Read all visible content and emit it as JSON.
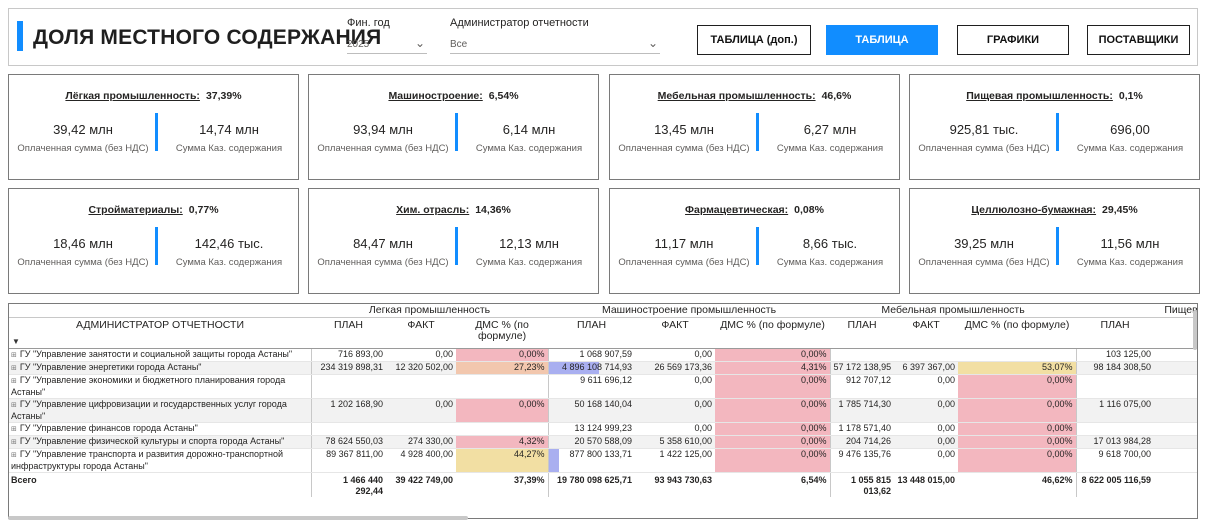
{
  "header": {
    "title": "ДОЛЯ МЕСТНОГО СОДЕРЖАНИЯ",
    "year_label": "Фин. год",
    "year_value": "2025",
    "admin_label": "Администратор отчетности",
    "admin_value": "Все",
    "buttons": [
      "ТАБЛИЦА (доп.)",
      "ТАБЛИЦА",
      "ГРАФИКИ",
      "ПОСТАВЩИКИ"
    ],
    "active_button": "ТАБЛИЦА",
    "accent_color": "#118dff"
  },
  "cards": [
    {
      "name": "Лёгкая промышленность:",
      "pct": "37,39%",
      "paid": "39,42 млн",
      "paid_label": "Оплаченная сумма (без НДС)",
      "kaz": "14,74 млн",
      "kaz_label": "Сумма Каз. содержания"
    },
    {
      "name": "Машиностроение:",
      "pct": "6,54%",
      "paid": "93,94 млн",
      "paid_label": "Оплаченная сумма (без НДС)",
      "kaz": "6,14 млн",
      "kaz_label": "Сумма Каз. содержания"
    },
    {
      "name": "Мебельная промышленность:",
      "pct": "46,6%",
      "paid": "13,45 млн",
      "paid_label": "Оплаченная сумма (без НДС)",
      "kaz": "6,27 млн",
      "kaz_label": "Сумма Каз. содержания"
    },
    {
      "name": "Пищевая промышленность:",
      "pct": "0,1%",
      "paid": "925,81 тыс.",
      "paid_label": "Оплаченная сумма (без НДС)",
      "kaz": "696,00",
      "kaz_label": "Сумма Каз. содержания"
    },
    {
      "name": "Стройматериалы:",
      "pct": "0,77%",
      "paid": "18,46 млн",
      "paid_label": "Оплаченная сумма (без НДС)",
      "kaz": "142,46 тыс.",
      "kaz_label": "Сумма Каз. содержания"
    },
    {
      "name": "Хим. отрасль:",
      "pct": "14,36%",
      "paid": "84,47 млн",
      "paid_label": "Оплаченная сумма (без НДС)",
      "kaz": "12,13 млн",
      "kaz_label": "Сумма Каз. содержания"
    },
    {
      "name": "Фармацевтическая:",
      "pct": "0,08%",
      "paid": "11,17 млн",
      "paid_label": "Оплаченная сумма (без НДС)",
      "kaz": "8,66 тыс.",
      "kaz_label": "Сумма Каз. содержания"
    },
    {
      "name": "Целлюлозно-бумажная:",
      "pct": "29,45%",
      "paid": "39,25 млн",
      "paid_label": "Оплаченная сумма (без НДС)",
      "kaz": "11,56 млн",
      "kaz_label": "Сумма Каз. содержания"
    }
  ],
  "table": {
    "groups": [
      "Легкая промышленность",
      "Машиностроение промышленность",
      "Мебельная промышленность",
      "Пищевая"
    ],
    "columns": [
      "АДМИНИСТРАТОР ОТЧЕТНОСТИ",
      "ПЛАН",
      "ФАКТ",
      "ДМС % (по формуле)",
      "ПЛАН",
      "ФАКТ",
      "ДМС % (по формуле)",
      "ПЛАН",
      "ФАКТ",
      "ДМС % (по формуле)",
      "ПЛАН"
    ],
    "sort_indicator": "▼",
    "rows": [
      {
        "name": "ГУ \"Управление занятости и социальной защиты города Астаны\"",
        "cells": [
          "716 893,00",
          "0,00",
          "0,00%",
          "1 068 907,59",
          "0,00",
          "0,00%",
          "",
          "",
          "",
          "103 125,00"
        ]
      },
      {
        "name": "ГУ \"Управление энергетики города Астаны\"",
        "cells": [
          "234 319 898,31",
          "12 320 502,00",
          "27,23%",
          "4 896 108 714,93",
          "26 569 173,36",
          "4,31%",
          "57 172 138,95",
          "6 397 367,00",
          "53,07%",
          "98 184 308,50"
        ]
      },
      {
        "name": "ГУ \"Управление экономики и бюджетного планирования города Астаны\"",
        "cells": [
          "",
          "",
          "",
          "9 611 696,12",
          "0,00",
          "0,00%",
          "912 707,12",
          "0,00",
          "0,00%",
          ""
        ]
      },
      {
        "name": "ГУ \"Управление цифровизации и государственных услуг города Астаны\"",
        "cells": [
          "1 202 168,90",
          "0,00",
          "0,00%",
          "50 168 140,04",
          "0,00",
          "0,00%",
          "1 785 714,30",
          "0,00",
          "0,00%",
          "1 116 075,00"
        ]
      },
      {
        "name": "ГУ \"Управление финансов города Астаны\"",
        "cells": [
          "",
          "",
          "",
          "13 124 999,23",
          "0,00",
          "0,00%",
          "1 178 571,40",
          "0,00",
          "0,00%",
          ""
        ]
      },
      {
        "name": "ГУ \"Управление физической культуры и спорта города Астаны\"",
        "cells": [
          "78 624 550,03",
          "274 330,00",
          "4,32%",
          "20 570 588,09",
          "5 358 610,00",
          "0,00%",
          "204 714,26",
          "0,00",
          "0,00%",
          "17 013 984,28"
        ]
      },
      {
        "name": "ГУ \"Управление транспорта и развития дорожно-транспортной инфраструктуры города Астаны\"",
        "cells": [
          "89 367 811,00",
          "4 928 400,00",
          "44,27%",
          "877 800 133,71",
          "1 422 125,00",
          "0,00%",
          "9 476 135,76",
          "0,00",
          "0,00%",
          "9 618 700,00"
        ]
      }
    ],
    "total": {
      "name": "Всего",
      "cells": [
        "1 466 440 292,44",
        "39 422 749,00",
        "37,39%",
        "19 780 098 625,71",
        "93 943 730,63",
        "6,54%",
        "1 055 815 013,62",
        "13 448 015,00",
        "46,62%",
        "8 622 005 116,59"
      ]
    },
    "colors": {
      "red": "#f3b7bf",
      "orange": "#f2c7ae",
      "yellow": "#f2dfa3",
      "databar": "#a9aff0"
    }
  }
}
